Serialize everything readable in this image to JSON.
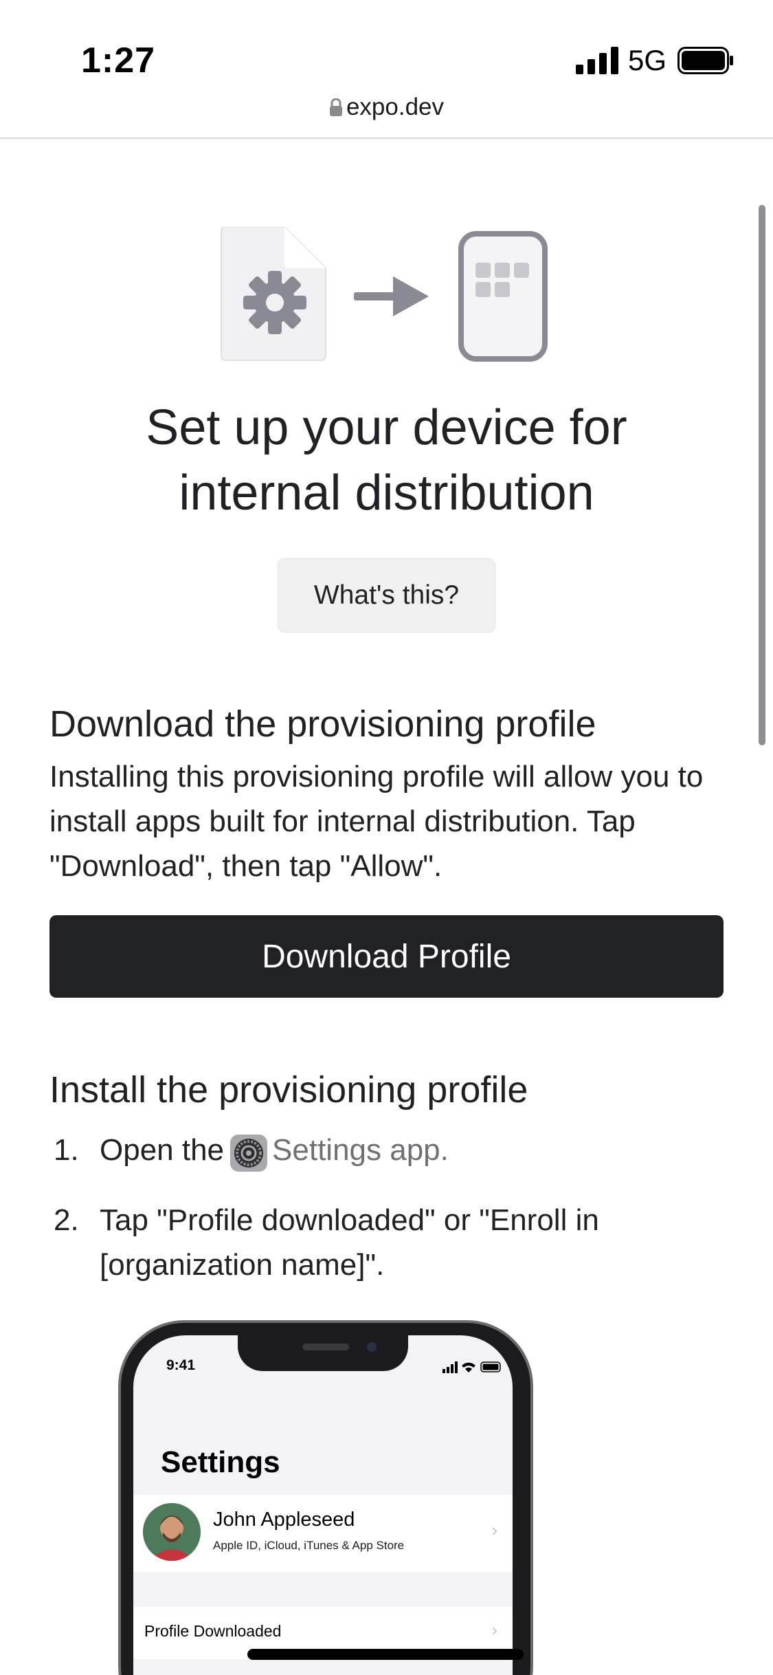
{
  "status_bar": {
    "time": "1:27",
    "network": "5G"
  },
  "browser": {
    "url": "expo.dev"
  },
  "page": {
    "title_line1": "Set up your device for",
    "title_line2": "internal distribution",
    "whats_this_label": "What's this?",
    "download_section": {
      "heading": "Download the provisioning profile",
      "description": "Installing this provisioning profile will allow you to install apps built for internal distribution. Tap \"Download\", then tap \"Allow\".",
      "button_label": "Download Profile"
    },
    "install_section": {
      "heading": "Install the provisioning profile",
      "steps": [
        {
          "number": "1.",
          "text_before": "Open the",
          "link_text": "Settings app."
        },
        {
          "number": "2.",
          "text": "Tap \"Profile downloaded\" or \"Enroll in [organization name]\"."
        }
      ]
    }
  },
  "phone_mockup": {
    "time": "9:41",
    "screen_title": "Settings",
    "user_name": "John Appleseed",
    "user_subtitle": "Apple ID, iCloud, iTunes & App Store",
    "profile_row_label": "Profile Downloaded",
    "chevron": "›"
  },
  "colors": {
    "text": "#1f2125",
    "button_dark": "#1f2125",
    "button_light": "#f0f0f1",
    "icon_gray": "#8a8a94",
    "link_gray": "#6e7075"
  }
}
